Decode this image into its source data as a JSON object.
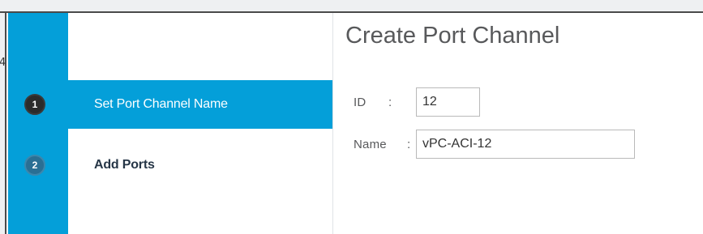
{
  "wizard": {
    "title": "Create Port Channel",
    "steps": [
      {
        "number": "1",
        "label": "Set Port Channel Name",
        "active": true
      },
      {
        "number": "2",
        "label": "Add Ports",
        "active": false
      }
    ]
  },
  "form": {
    "id_label": "ID",
    "id_colon": ":",
    "id_value": "12",
    "name_label": "Name",
    "name_colon": ":",
    "name_value": "vPC-ACI-12"
  },
  "colors": {
    "accent": "#049fd9",
    "step_active_circle": "#2b2b2b",
    "step_inactive_circle": "#2a6f94"
  }
}
